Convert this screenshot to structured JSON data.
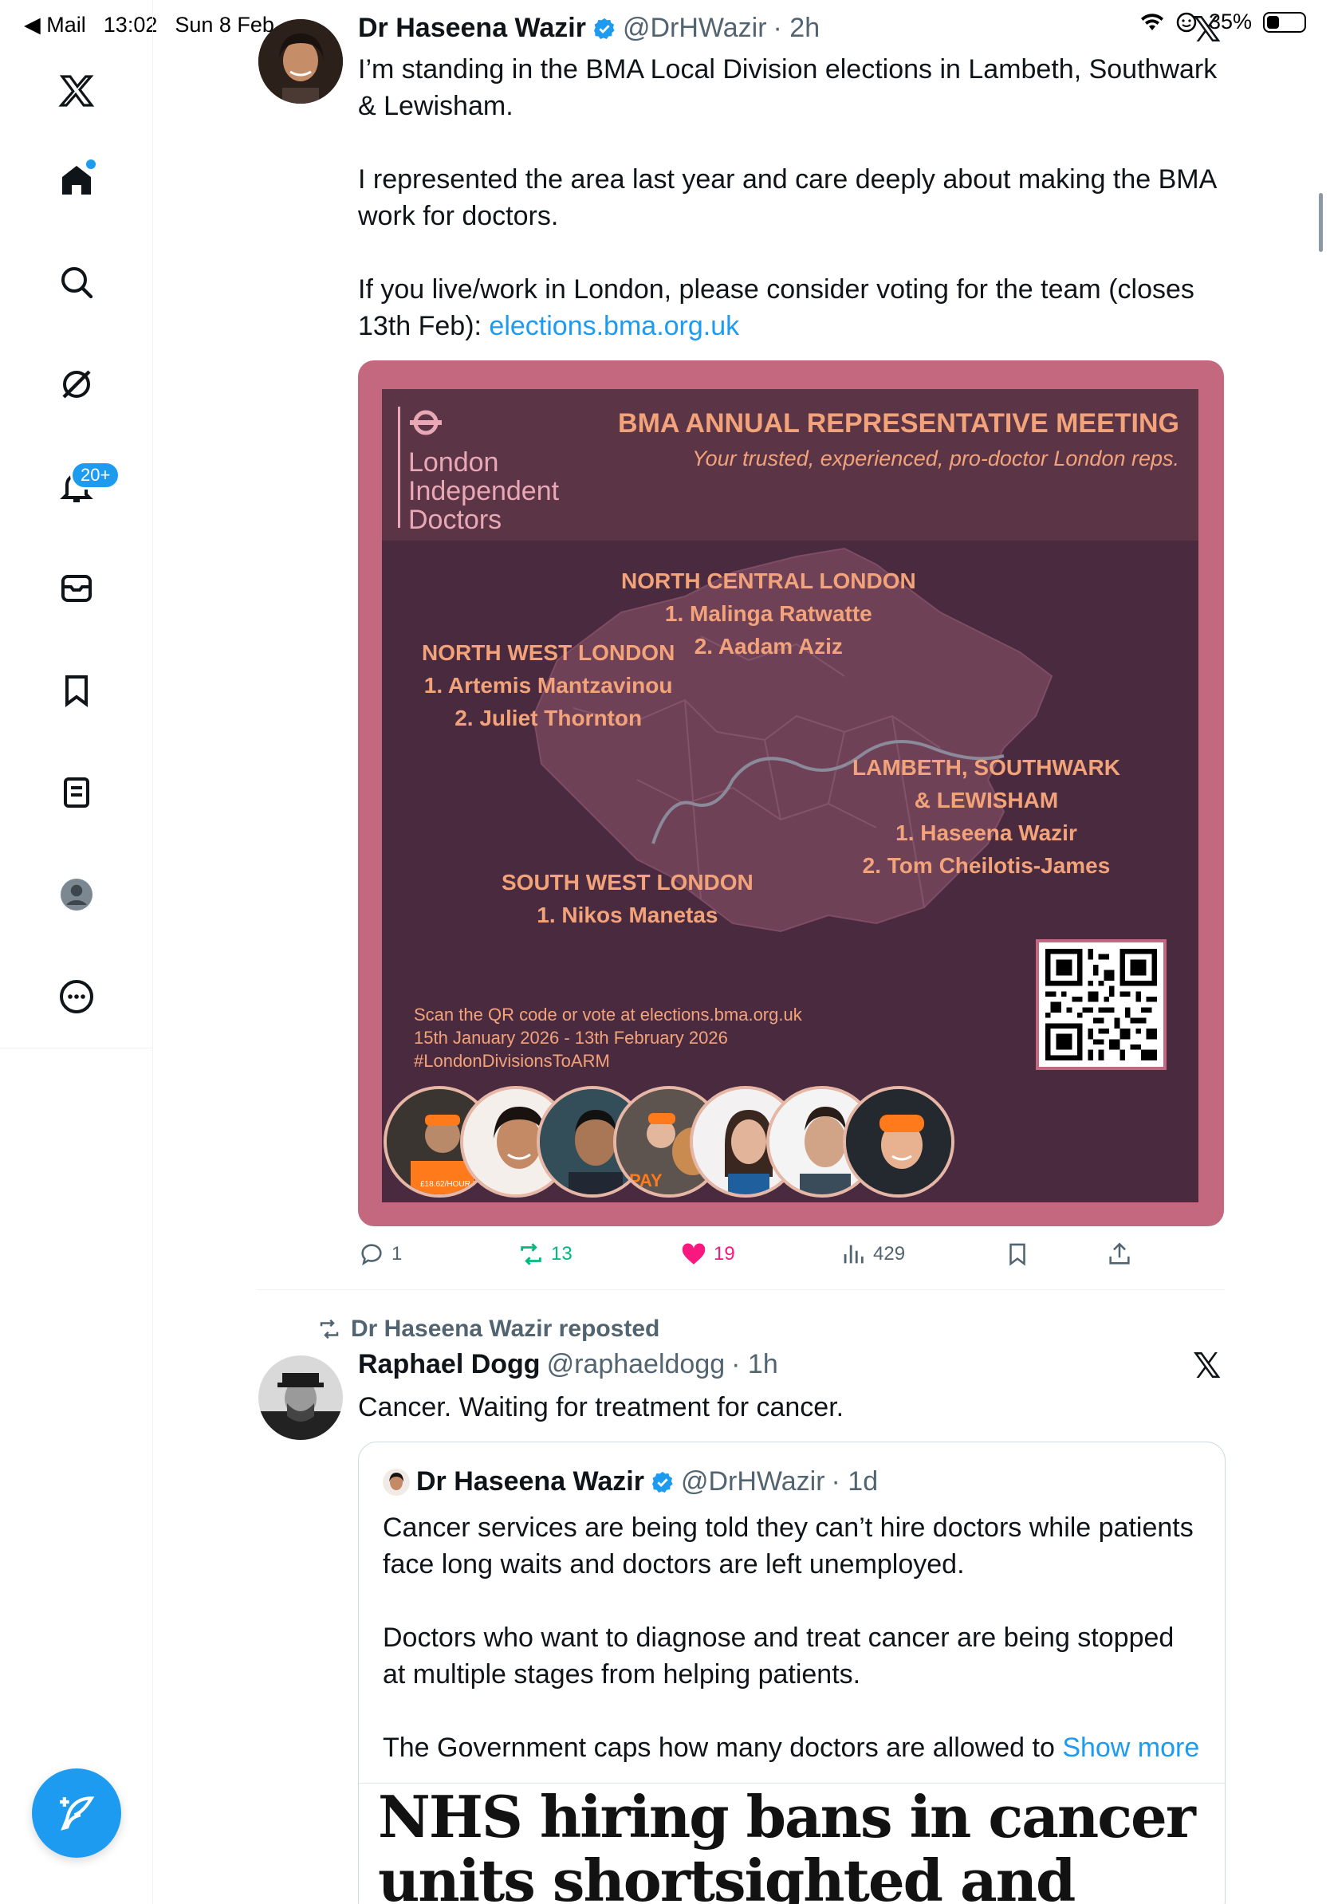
{
  "status_bar": {
    "back_app": "◀ Mail",
    "time": "13:02",
    "date": "Sun 8 Feb",
    "battery": "35%",
    "battery_level": 0.35
  },
  "sidebar": {
    "items": [
      {
        "name": "x-logo"
      },
      {
        "name": "home"
      },
      {
        "name": "explore"
      },
      {
        "name": "grok"
      },
      {
        "name": "notifications",
        "badge": "20+"
      },
      {
        "name": "messages"
      },
      {
        "name": "bookmarks"
      },
      {
        "name": "lists"
      },
      {
        "name": "profile"
      },
      {
        "name": "more"
      }
    ]
  },
  "tweet1": {
    "display_name": "Dr Haseena Wazir",
    "handle": "@DrHWazir",
    "time": "· 2h",
    "paragraphs": [
      "I’m standing in the BMA Local Division elections in Lambeth, Southwark & Lewisham.",
      "I represented the area last year and care deeply about making the BMA work for doctors."
    ],
    "p3_text": "If you live/work in London, please consider voting for the team (closes 13th Feb): ",
    "p3_link": "elections.bma.org.uk",
    "poster": {
      "logo_text_1": "London",
      "logo_text_2": "Independent",
      "logo_text_3": "Doctors",
      "title": "BMA ANNUAL REPRESENTATIVE MEETING",
      "subtitle": "Your trusted, experienced, pro-doctor London reps.",
      "ncl_title": "NORTH CENTRAL LONDON",
      "ncl_1": "1. Malinga Ratwatte",
      "ncl_2": "2. Aadam Aziz",
      "nwl_title": "NORTH WEST LONDON",
      "nwl_1": "1. Artemis Mantzavinou",
      "nwl_2": "2. Juliet Thornton",
      "lsl_title_1": "LAMBETH, SOUTHWARK",
      "lsl_title_2": "& LEWISHAM",
      "lsl_1": "1. Haseena Wazir",
      "lsl_2": "2. Tom Cheilotis-James",
      "swl_title": "SOUTH WEST LONDON",
      "swl_1": "1. Nikos Manetas",
      "footer_1": "Scan the QR code or vote at elections.bma.org.uk",
      "footer_2": "15th January 2026 - 13th February 2026",
      "footer_3": "#LondonDivisionsToARM",
      "face_text_1": "£18.62/HOUR IS",
      "face_text_2": "PAY"
    },
    "actions": {
      "replies": "1",
      "reposts": "13",
      "likes": "19",
      "views": "429"
    }
  },
  "tweet2": {
    "repost_label": "Dr Haseena Wazir reposted",
    "display_name": "Raphael Dogg",
    "handle": "@raphaeldogg",
    "time": "· 1h",
    "text": "Cancer. Waiting for treatment for cancer.",
    "quote": {
      "display_name": "Dr Haseena Wazir",
      "handle": "@DrHWazir",
      "time": "· 1d",
      "paragraphs": [
        "Cancer services are being told they can’t hire doctors while patients face long waits and doctors are left unemployed.",
        "Doctors who want to diagnose and treat cancer are being stopped at multiple stages from helping patients."
      ],
      "p3_text": "The Government caps how many doctors are allowed to ",
      "show_more": "Show more",
      "article_headline": "NHS hiring bans in cancer units shortsighted and dangerous,"
    }
  },
  "colors": {
    "accent": "#1d9bf0",
    "like": "#f91880",
    "repost": "#00ba7c",
    "poster_frame": "#c3687f",
    "poster_bg": "#4a2a3e",
    "poster_text": "#f3a37a"
  }
}
